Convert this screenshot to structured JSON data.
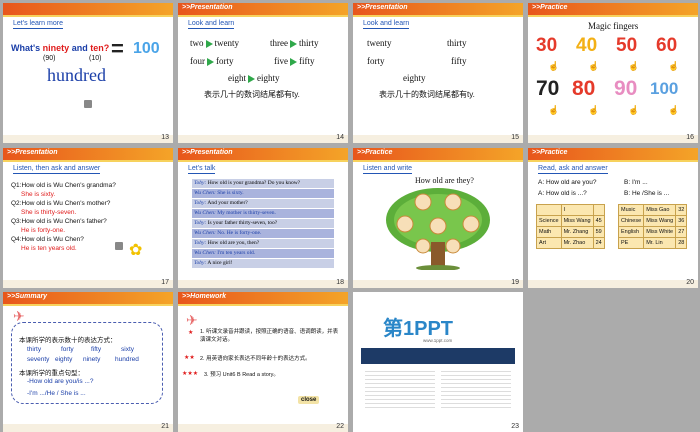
{
  "slides": [
    {
      "num": "13",
      "header": "",
      "subtitle": "Let's learn more",
      "q": "What's",
      "q_ninety": "ninety",
      "q_and": "and",
      "q_ten": "ten?",
      "n90": "(90)",
      "n10": "(10)",
      "equals": "=",
      "result": "100",
      "word": "hundred"
    },
    {
      "num": "14",
      "header": ">>Presentation",
      "subtitle": "Look and learn",
      "pairs": [
        [
          "two",
          "twenty"
        ],
        [
          "three",
          "thirty"
        ],
        [
          "four",
          "forty"
        ],
        [
          "five",
          "fifty"
        ],
        [
          "eight",
          "eighty"
        ]
      ],
      "note": "表示几十的数词结尾都有ty."
    },
    {
      "num": "15",
      "header": ">>Presentation",
      "subtitle": "Look and learn",
      "words": [
        "twenty",
        "thirty",
        "forty",
        "fifty",
        "eighty"
      ],
      "note": "表示几十的数词结尾都有ty."
    },
    {
      "num": "16",
      "header": ">>Practice",
      "title": "Magic fingers",
      "numbers": [
        "30",
        "40",
        "50",
        "60",
        "70",
        "80",
        "90",
        "100"
      ],
      "number_colors": [
        "#e53a2b",
        "#f3b015",
        "#e53a2b",
        "#e53a2b",
        "#222222",
        "#e53a2b",
        "#e88dc1",
        "#5aa0e0"
      ]
    },
    {
      "num": "17",
      "header": ">>Presentation",
      "subtitle": "Listen, then ask and answer",
      "qa": [
        [
          "Q1:How old is Wu Chen's grandma?",
          "She is sixty."
        ],
        [
          "Q2:How old is Wu Chen's mother?",
          "She is thirty-seven."
        ],
        [
          "Q3:How old is Wu Chen's father?",
          "He is forty-one."
        ],
        [
          "Q4:How old is Wu Chen?",
          "He is ten years old."
        ]
      ]
    },
    {
      "num": "18",
      "header": ">>Presentation",
      "subtitle": "Let's talk",
      "lines": [
        [
          "Toby:",
          "How old is your grandma? Do you know?"
        ],
        [
          "Wu Chen:",
          "She is sixty."
        ],
        [
          "Toby:",
          "And your mother?"
        ],
        [
          "Wu Chen:",
          "My mother is thirty-seven."
        ],
        [
          "Toby:",
          "Is your father thirty-seven, too?"
        ],
        [
          "Wu Chen:",
          "No. He is forty-one."
        ],
        [
          "Toby:",
          "How old are you, then?"
        ],
        [
          "Wu Chen:",
          "I'm ten years old."
        ],
        [
          "Toby:",
          "A nice girl!"
        ]
      ]
    },
    {
      "num": "19",
      "header": ">>Practice",
      "subtitle": "Listen and write",
      "title": "How old are they?"
    },
    {
      "num": "20",
      "header": ">>Practice",
      "subtitle": "Read, ask and answer",
      "a1": "A: How old are you?",
      "b1": "B: I'm ...",
      "a2": "A: How old is ...?",
      "b2": "B: He /She is ...",
      "table1": [
        [
          "",
          "I"
        ],
        [
          "Science",
          "Miss Wang",
          "45"
        ],
        [
          "Math",
          "Mr. Zhang",
          "59"
        ],
        [
          "Art",
          "Mr. Zhao",
          "24"
        ]
      ],
      "table2": [
        [
          "Music",
          "Miss Gao",
          "32"
        ],
        [
          "Chinese",
          "Miss Wang",
          "36"
        ],
        [
          "English",
          "Miss White",
          "27"
        ],
        [
          "PE",
          "Mr. Lin",
          "28"
        ]
      ]
    },
    {
      "num": "21",
      "header": ">>Summary",
      "l1": "本课所学的表示数十的表达方式：",
      "nums": [
        "thirty",
        "forty",
        "fifty",
        "sixty",
        "seventy",
        "eighty",
        "ninety",
        "hundred"
      ],
      "l2": "本课所学的重点句型：",
      "s1": "-How old are you/is ...?",
      "s2": "-I'm .../He / She is ..."
    },
    {
      "num": "22",
      "header": ">>Homework",
      "h1": "1. 听课文录音并跟读，按照正确的语音、语调朗读，并表演课文对话。",
      "h2": "2. 用英语向家长表达不同年龄十的表达方式。",
      "h3": "3. 预习 Unit6 B Read a story。",
      "stars": [
        "★",
        "★★",
        "★★★"
      ],
      "close": "close"
    },
    {
      "num": "23",
      "logo": "第1PPT",
      "logo_sub": "www.1ppt.com"
    }
  ]
}
